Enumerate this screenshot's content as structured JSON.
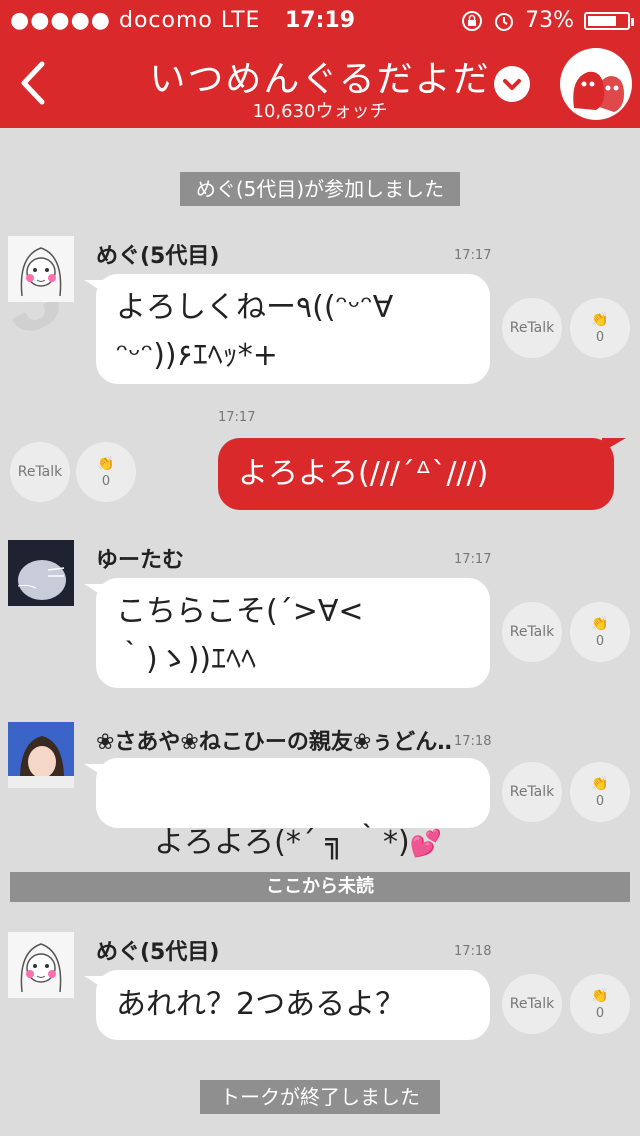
{
  "status": {
    "carrier": "●●●●● docomo  LTE",
    "time": "17:19",
    "battery": "73%",
    "battery_level": 0.73
  },
  "header": {
    "title": "いつめんぐるだよだ",
    "subtitle": "10,630ウォッチ"
  },
  "system": {
    "joined": "めぐ(5代目)が参加しました",
    "unread": "ここから未読",
    "ended": "トークが終了しました"
  },
  "actions": {
    "retalk": "ReTalk"
  },
  "messages": [
    {
      "name": "めぐ(5代目)",
      "time": "17:17",
      "text": "よろしくねー٩((ᵔᵕᵔ∀\nᵔᵕᵔ))۶ｴﾍｯ*+",
      "count": "0"
    },
    {
      "time": "17:17",
      "text": "よろよろ(///´ᐞ`///)",
      "count": "0"
    },
    {
      "name": "ゆーたむ",
      "time": "17:17",
      "text": "こちらこそ(´>∀<\n｀)ゝ))ｴﾍﾍ",
      "count": "0"
    },
    {
      "name": "❀さあや❀ねこひーの親友❀ぅどん…",
      "time": "17:18",
      "text": "よろよろ(*´ ╗ ｀*)",
      "count": "0"
    },
    {
      "name": "めぐ(5代目)",
      "time": "17:18",
      "text": "あれれ？2つあるよ？",
      "count": "0"
    }
  ],
  "colors": {
    "brand": "#d9292b",
    "background": "#dcdcdc",
    "system_bar": "#8f8f8f"
  }
}
